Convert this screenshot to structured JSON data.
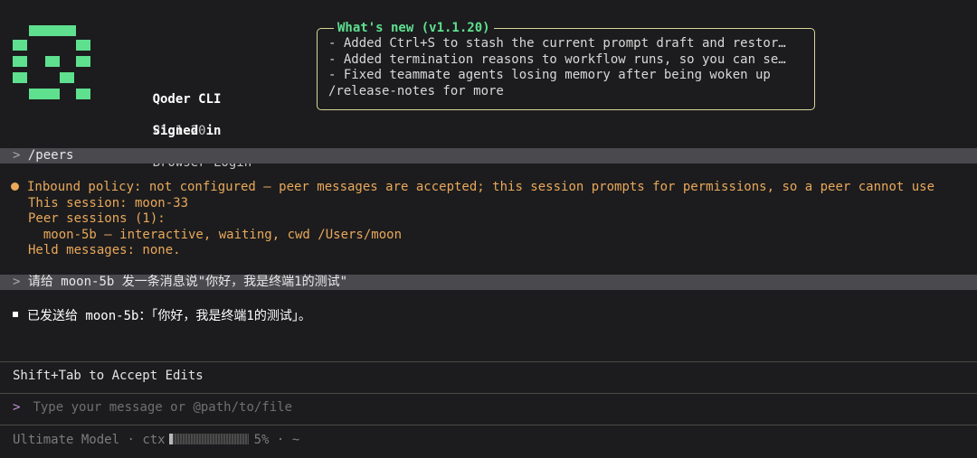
{
  "app": {
    "name": "Qoder CLI",
    "version": "v1.1.20",
    "signed_in_label": "Signed in",
    "signed_in_method": "Browser Login"
  },
  "whats_new": {
    "title": "What's new (v1.1.20)",
    "items": [
      "- Added Ctrl+S to stash the current prompt draft and restor…",
      "- Added termination reasons to workflow runs, so you can se…",
      "- Fixed teammate agents losing memory after being woken up"
    ],
    "link": "/release-notes for more"
  },
  "history": {
    "cmd1": "/peers",
    "peers_output": {
      "policy": "Inbound policy: not configured — peer messages are accepted; this session prompts for permissions, so a peer cannot use",
      "session": "This session: moon-33",
      "peer_sessions": "Peer sessions (1):",
      "peer_item": "  moon-5b — interactive, waiting, cwd /Users/moon",
      "held": "Held messages: none."
    },
    "cmd2": "请给 moon-5b 发一条消息说\"你好，我是终端1的测试\"",
    "reply": "已发送给 moon-5b：「你好，我是终端1的测试」。"
  },
  "prompt_symbol": ">",
  "hint": "Shift+Tab to Accept Edits",
  "input": {
    "value": "",
    "placeholder": "Type your message or @path/to/file"
  },
  "status": {
    "model": "Ultimate Model",
    "sep": "·",
    "ctx_label": "ctx",
    "ctx_percent_text": "5%",
    "ctx_fraction": 0.05,
    "cwd": "~"
  },
  "colors": {
    "accent_green": "#5ee08f",
    "accent_purple": "#c58fd8",
    "warning_orange": "#e9a85a",
    "box_border": "#d7d69a"
  }
}
